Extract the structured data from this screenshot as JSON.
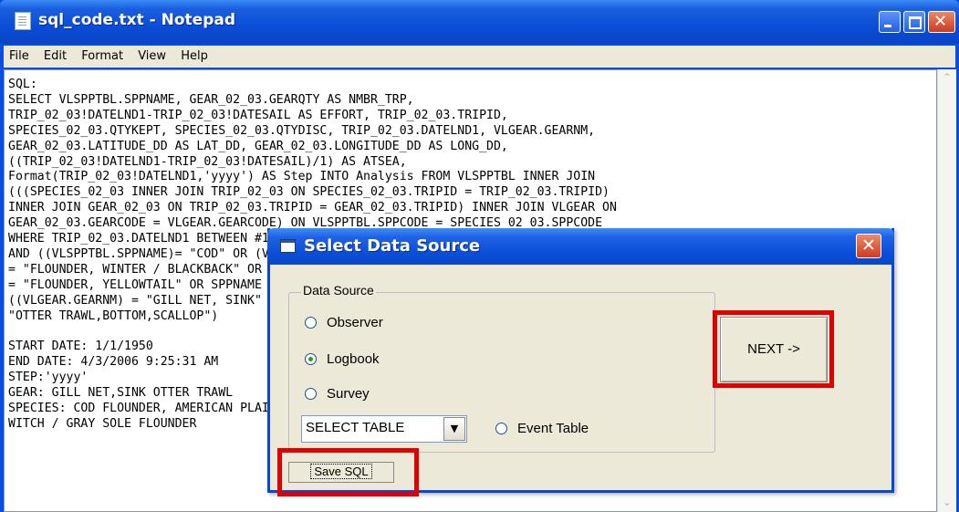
{
  "window": {
    "title": "sql_code.txt - Notepad",
    "menu": [
      "File",
      "Edit",
      "Format",
      "View",
      "Help"
    ]
  },
  "editor": {
    "lines": [
      "SQL:",
      "SELECT VLSPPTBL.SPPNAME, GEAR_02_03.GEARQTY AS NMBR_TRP,",
      "TRIP_02_03!DATELND1-TRIP_02_03!DATESAIL AS EFFORT, TRIP_02_03.TRIPID,",
      "SPECIES_02_03.QTYKEPT, SPECIES_02_03.QTYDISC, TRIP_02_03.DATELND1, VLGEAR.GEARNM,",
      "GEAR_02_03.LATITUDE_DD AS LAT_DD, GEAR_02_03.LONGITUDE_DD AS LONG_DD,",
      "((TRIP_02_03!DATELND1-TRIP_02_03!DATESAIL)/1) AS ATSEA,",
      "Format(TRIP_02_03!DATELND1,'yyyy') AS Step INTO Analysis FROM VLSPPTBL INNER JOIN",
      "(((SPECIES_02_03 INNER JOIN TRIP_02_03 ON SPECIES_02_03.TRIPID = TRIP_02_03.TRIPID)",
      "INNER JOIN GEAR_02_03 ON TRIP_02_03.TRIPID = GEAR_02_03.TRIPID) INNER JOIN VLGEAR ON",
      "GEAR_02_03.GEARCODE = VLGEAR.GEARCODE) ON VLSPPTBL.SPPCODE = SPECIES_02_03.SPPCODE",
      "WHERE TRIP_02_03.DATELND1 BETWEEN #1/1/1950# AND #4/3/2006 9:25:31 AM# AND #4/3/2006 9:25:31 AM#",
      "AND ((VLSPPTBL.SPPNAME)= \"COD\" OR (VLSPPTBL.SPPNAME) = \"FLOUNDER\" OR (VLSPPTBL.SPPNAME",
      "= \"FLOUNDER, WINTER / BLACKBACK\" OR (VLSPPTBL.SPPNAME) = \"AMERICAN PLAICE\" OR (SPPNAME",
      "= \"FLOUNDER, YELLOWTAIL\" OR SPPNAME",
      "((VLGEAR.GEARNM) = \"GILL NET, SINK\" OR (VLGEAR.GEARNM) = \"OTTER TRAWL\" OR (GEARNM) =",
      "\"OTTER TRAWL,BOTTOM,SCALLOP\")",
      "",
      "START DATE: 1/1/1950",
      "END DATE: 4/3/2006 9:25:31 AM",
      "STEP:'yyyy'",
      "GEAR: GILL NET,SINK OTTER TRAWL",
      "SPECIES: COD FLOUNDER, AMERICAN PLAICE",
      "WITCH / GRAY SOLE FLOUNDER"
    ]
  },
  "dialog": {
    "title": "Select Data Source",
    "group_label": "Data Source",
    "options": [
      {
        "label": "Observer",
        "selected": false
      },
      {
        "label": "Logbook",
        "selected": true
      },
      {
        "label": "Survey",
        "selected": false
      }
    ],
    "select_value": "SELECT TABLE",
    "event_table_label": "Event Table",
    "next_label": "NEXT ->",
    "save_label": "Save SQL"
  },
  "highlight_color": "#e00000"
}
